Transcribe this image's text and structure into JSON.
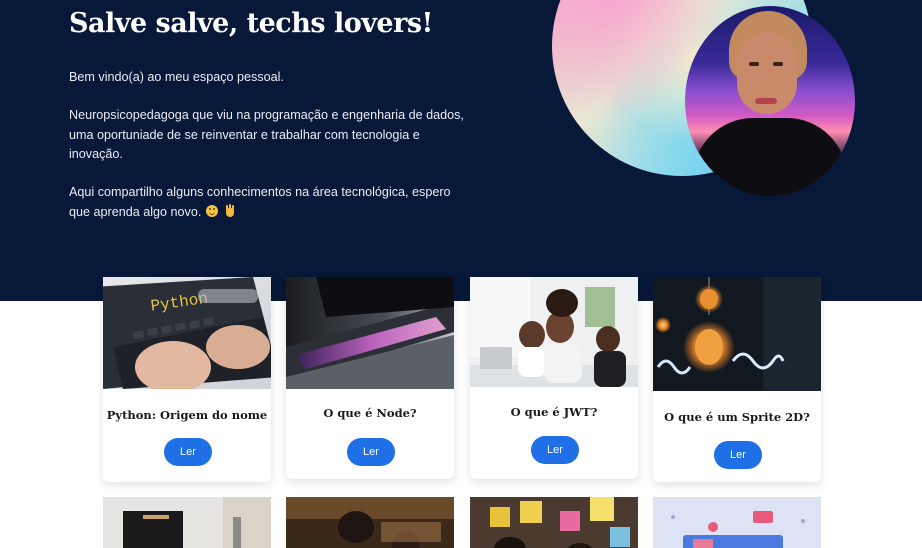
{
  "hero": {
    "title": "Salve salve, techs lovers!",
    "paragraph1": "Bem vindo(a) ao meu espaço pessoal.",
    "paragraph2": "Neuropsicopedagoga que viu na programação e engenharia de dados, uma oportuniade de se reinventar e trabalhar com tecnologia e inovação.",
    "paragraph3": "Aqui compartilho alguns conhecimentos na área tecnológica, espero que aprenda algo novo.",
    "emoji_icons": [
      "smiling-face-icon",
      "waving-hand-icon"
    ]
  },
  "cards": [
    {
      "title": "Python: Origem do nome",
      "button": "Ler",
      "image_text": "Python"
    },
    {
      "title": "O que é Node?",
      "button": "Ler"
    },
    {
      "title": "O que é JWT?",
      "button": "Ler"
    },
    {
      "title": "O que é um Sprite 2D?",
      "button": "Ler"
    }
  ],
  "colors": {
    "hero_bg": "#071838",
    "button_bg": "#1f6fe6",
    "card_bg": "#ffffff"
  }
}
